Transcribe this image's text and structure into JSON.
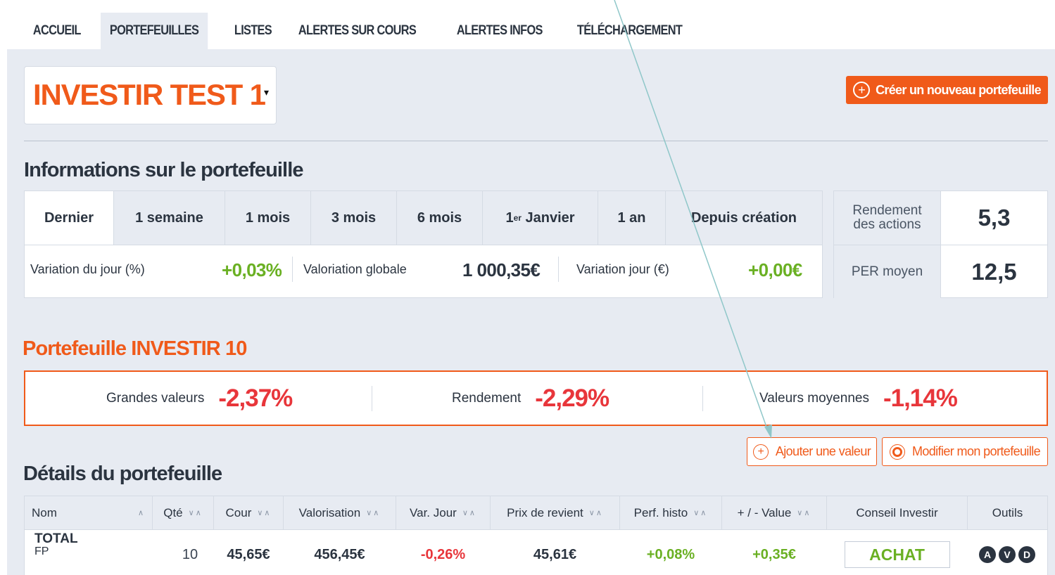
{
  "nav": {
    "tabs": [
      "ACCUEIL",
      "PORTEFEUILLES",
      "LISTES",
      "ALERTES SUR COURS",
      "ALERTES INFOS",
      "TÉLÉCHARGEMENT"
    ],
    "active": "PORTEFEUILLES"
  },
  "portfolio": {
    "name": "INVESTIR TEST 1",
    "caret": "▾",
    "create_button": "Créer un nouveau portefeuille"
  },
  "info": {
    "title": "Informations sur le portefeuille",
    "periods": {
      "dernier": "Dernier",
      "semaine": "1 semaine",
      "mois": "1 mois",
      "trois_mois": "3 mois",
      "six_mois": "6 mois",
      "janvier_pre": "1",
      "janvier_sup": "er",
      "janvier_post": " Janvier",
      "an": "1 an",
      "creation": "Depuis création"
    },
    "variation_jour_pct_label": "Variation du jour (%)",
    "variation_jour_pct": "+0,03%",
    "valorisation_label": "Valoriation globale",
    "valorisation": "1 000,35€",
    "variation_jour_eur_label": "Variation jour (€)",
    "variation_jour_eur": "+0,00€"
  },
  "stats": {
    "rendement_label_1": "Rendement",
    "rendement_label_2": "des actions",
    "rendement": "5,3",
    "per_label": "PER moyen",
    "per": "12,5"
  },
  "investir10": {
    "title": "Portefeuille INVESTIR 10",
    "grandes_label": "Grandes valeurs",
    "grandes": "-2,37%",
    "rendement_label": "Rendement",
    "rendement": "-2,29%",
    "moyennes_label": "Valeurs moyennes",
    "moyennes": "-1,14%"
  },
  "actions": {
    "add": "Ajouter une valeur",
    "modify": "Modifier mon portefeuille"
  },
  "details": {
    "title": "Détails du portefeuille",
    "headers": {
      "nom": "Nom",
      "qte": "Qté",
      "cour": "Cour",
      "valorisation": "Valorisation",
      "var": "Var. Jour",
      "prix": "Prix de revient",
      "perf": "Perf. histo",
      "value": "+ / - Value",
      "conseil": "Conseil Investir",
      "outils": "Outils"
    },
    "sort_icon": "∨∧",
    "sort_up_icon": "∧",
    "row": {
      "name": "TOTAL",
      "sub": "FP",
      "qte": "10",
      "cour": "45,65€",
      "valorisation": "456,45€",
      "var": "-0,26%",
      "prix": "45,61€",
      "perf": "+0,08%",
      "value": "+0,35€",
      "conseil": "ACHAT",
      "tools": [
        "A",
        "V",
        "D"
      ]
    }
  },
  "colors": {
    "accent": "#f05a1a",
    "positive": "#6ab023",
    "negative": "#e8363b",
    "panel": "#e7ebf2",
    "arrow": "#8fc7c9"
  }
}
